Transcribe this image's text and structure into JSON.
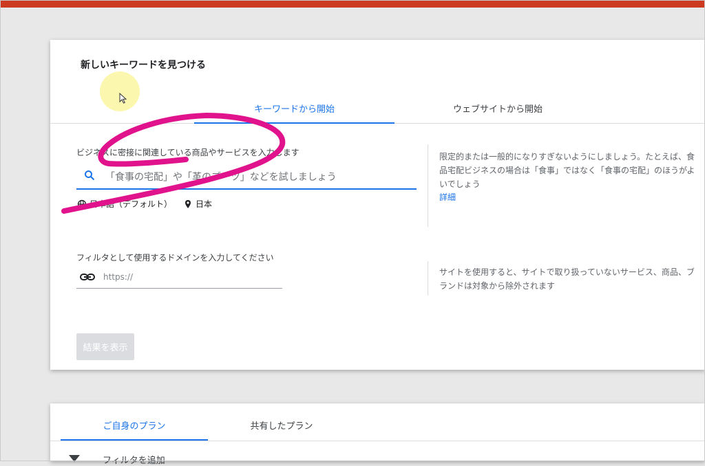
{
  "main_card": {
    "title": "新しいキーワードを見つける",
    "tabs": [
      {
        "label": "キーワードから開始",
        "active": true
      },
      {
        "label": "ウェブサイトから開始",
        "active": false
      }
    ],
    "keyword_section": {
      "label": "ビジネスに密接に関連している商品やサービスを入力します",
      "placeholder": "「食事の宅配」や「革のブーツ」などを試しましょう",
      "language": "日本語（デフォルト）",
      "location": "日本",
      "help_text": "限定的または一般的になりすぎないようにしましょう。たとえば、食品宅配ビジネスの場合は「食事」ではなく「食事の宅配」のほうがよいでしょう",
      "help_link": "詳細"
    },
    "domain_section": {
      "label": "フィルタとして使用するドメインを入力してください",
      "placeholder": "https://",
      "help_text": "サイトを使用すると、サイトで取り扱っていないサービス、商品、ブランドは対象から除外されます"
    },
    "submit_button": "結果を表示"
  },
  "plans_card": {
    "tabs": [
      {
        "label": "ご自身のプラン",
        "active": true
      },
      {
        "label": "共有したプラン",
        "active": false
      }
    ],
    "filter_label": "フィルタを追加"
  },
  "colors": {
    "accent": "#1a73e8",
    "top_bar": "#cc3b1f",
    "annotation": "#e0138c",
    "disabled_button": "#dadce0"
  },
  "icons": [
    "search-icon",
    "globe-icon",
    "location-pin-icon",
    "link-icon",
    "filter-icon",
    "cursor-icon"
  ]
}
